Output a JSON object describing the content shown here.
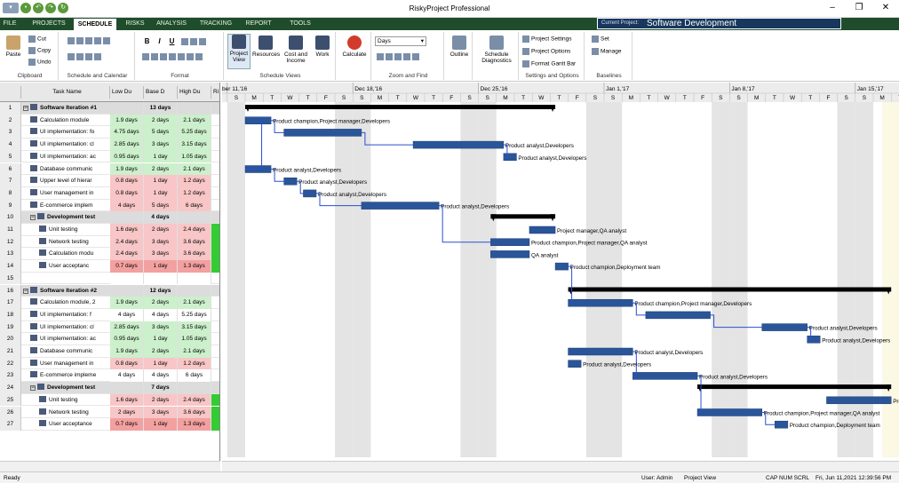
{
  "window": {
    "title": "RiskyProject Professional"
  },
  "tabs": [
    "FILE",
    "PROJECTS",
    "SCHEDULE",
    "RISKS",
    "ANALYSIS",
    "TRACKING",
    "REPORT",
    "TOOLS"
  ],
  "active_tab": "SCHEDULE",
  "current_project": {
    "label": "Current Project:",
    "value": "Software Development"
  },
  "ribbon": {
    "clipboard": {
      "paste": "Paste",
      "cut": "Cut",
      "copy": "Copy",
      "undo": "Undo",
      "label": "Clipboard"
    },
    "schedule_calendar": {
      "label": "Schedule and Calendar"
    },
    "format": {
      "bold": "B",
      "italic": "I",
      "underline": "U",
      "label": "Format"
    },
    "views": {
      "project_view": "Project View",
      "resources": "Resources",
      "cost_income": "Cost and Income",
      "work": "Work",
      "label": "Schedule Views"
    },
    "calculate": {
      "label": "Calculate"
    },
    "zoom": {
      "select_value": "Days",
      "label": "Zoom and Find"
    },
    "outline": {
      "label": "Outline"
    },
    "diagnostics": {
      "label": "Schedule Diagnostics"
    },
    "settings": {
      "project_settings": "Project Settings",
      "project_options": "Project Options",
      "format_gantt": "Format Gantt Bar",
      "label": "Settings and Options"
    },
    "baselines": {
      "set": "Set",
      "manage": "Manage",
      "label": "Baselines"
    }
  },
  "grid": {
    "headers": {
      "task_name": "Task Name",
      "low": "Low Du",
      "base": "Base D",
      "high": "High Du",
      "risk": "Ri"
    },
    "rows": [
      {
        "n": "1",
        "name": "Software Iteration #1",
        "low": "",
        "base": "13 days",
        "high": "",
        "level": 0,
        "summary": true,
        "color": "summ"
      },
      {
        "n": "2",
        "name": "Calculation module",
        "low": "1.9 days",
        "base": "2 days",
        "high": "2.1 days",
        "level": 1,
        "color": "green"
      },
      {
        "n": "3",
        "name": "UI implementation: fo",
        "low": "4.75 days",
        "base": "5 days",
        "high": "5.25 days",
        "level": 1,
        "color": "green"
      },
      {
        "n": "4",
        "name": "UI implementation: cl",
        "low": "2.85 days",
        "base": "3 days",
        "high": "3.15 days",
        "level": 1,
        "color": "green"
      },
      {
        "n": "5",
        "name": "UI implementation: ac",
        "low": "0.95 days",
        "base": "1 day",
        "high": "1.05 days",
        "level": 1,
        "color": "green"
      },
      {
        "n": "6",
        "name": "Database communic",
        "low": "1.9 days",
        "base": "2 days",
        "high": "2.1 days",
        "level": 1,
        "color": "green"
      },
      {
        "n": "7",
        "name": "Upper level of hierar",
        "low": "0.8 days",
        "base": "1 day",
        "high": "1.2 days",
        "level": 1,
        "color": "red"
      },
      {
        "n": "8",
        "name": "User management in",
        "low": "0.8 days",
        "base": "1 day",
        "high": "1.2 days",
        "level": 1,
        "color": "red"
      },
      {
        "n": "9",
        "name": "E-commerce implem",
        "low": "4 days",
        "base": "5 days",
        "high": "6 days",
        "level": 1,
        "color": "red"
      },
      {
        "n": "10",
        "name": "Development test",
        "low": "",
        "base": "4 days",
        "high": "",
        "level": 1,
        "summary": true,
        "color": "summ"
      },
      {
        "n": "11",
        "name": "Unit testing",
        "low": "1.6 days",
        "base": "2 days",
        "high": "2.4 days",
        "level": 2,
        "color": "red",
        "risk": true
      },
      {
        "n": "12",
        "name": "Network testing",
        "low": "2.4 days",
        "base": "3 days",
        "high": "3.6 days",
        "level": 2,
        "color": "red",
        "risk": true
      },
      {
        "n": "13",
        "name": "Calculation modu",
        "low": "2.4 days",
        "base": "3 days",
        "high": "3.6 days",
        "level": 2,
        "color": "red",
        "risk": true
      },
      {
        "n": "14",
        "name": "User acceptanc",
        "low": "0.7 days",
        "base": "1 day",
        "high": "1.3 days",
        "level": 2,
        "color": "redd",
        "risk": true
      },
      {
        "n": "15",
        "name": "",
        "low": "",
        "base": "",
        "high": "",
        "level": 0,
        "color": "none"
      },
      {
        "n": "16",
        "name": "Software Iteration #2",
        "low": "",
        "base": "12 days",
        "high": "",
        "level": 0,
        "summary": true,
        "color": "summ"
      },
      {
        "n": "17",
        "name": "Calculation module, 2",
        "low": "1.9 days",
        "base": "2 days",
        "high": "2.1 days",
        "level": 1,
        "color": "green"
      },
      {
        "n": "18",
        "name": "UI implementation: f",
        "low": "4 days",
        "base": "4 days",
        "high": "5.25 days",
        "level": 1,
        "color": "white"
      },
      {
        "n": "19",
        "name": "UI implementation: cl",
        "low": "2.85 days",
        "base": "3 days",
        "high": "3.15 days",
        "level": 1,
        "color": "green"
      },
      {
        "n": "20",
        "name": "UI implementation: ac",
        "low": "0.95 days",
        "base": "1 day",
        "high": "1.05 days",
        "level": 1,
        "color": "green"
      },
      {
        "n": "21",
        "name": "Database communic",
        "low": "1.9 days",
        "base": "2 days",
        "high": "2.1 days",
        "level": 1,
        "color": "green"
      },
      {
        "n": "22",
        "name": "User management in",
        "low": "0.8 days",
        "base": "1 day",
        "high": "1.2 days",
        "level": 1,
        "color": "red"
      },
      {
        "n": "23",
        "name": "E-commerce impleme",
        "low": "4 days",
        "base": "4 days",
        "high": "6 days",
        "level": 1,
        "color": "white"
      },
      {
        "n": "24",
        "name": "Development test",
        "low": "",
        "base": "7 days",
        "high": "",
        "level": 1,
        "summary": true,
        "color": "summ"
      },
      {
        "n": "25",
        "name": "Unit testing",
        "low": "1.6 days",
        "base": "2 days",
        "high": "2.4 days",
        "level": 2,
        "color": "red",
        "risk": true
      },
      {
        "n": "26",
        "name": "Network testing",
        "low": "2 days",
        "base": "3 days",
        "high": "3.6 days",
        "level": 2,
        "color": "red",
        "risk": true
      },
      {
        "n": "27",
        "name": "User acceptance",
        "low": "0.7 days",
        "base": "1 day",
        "high": "1.3 days",
        "level": 2,
        "color": "redd",
        "risk": true
      }
    ]
  },
  "gantt": {
    "weeks": [
      "ber 11,'16",
      "Dec 18,'16",
      "Dec 25,'16",
      "Jan 1,'17",
      "Jan 8,'17",
      "Jan 15,'17"
    ],
    "day_letters": [
      "M",
      "T",
      "W",
      "T",
      "F",
      "S",
      "S"
    ],
    "bars": [
      {
        "row": 1,
        "start": 0,
        "end": 24,
        "type": "summary"
      },
      {
        "row": 2,
        "start": 0,
        "end": 2,
        "label": "Product champion,Project manager,Developers"
      },
      {
        "row": 3,
        "start": 3,
        "end": 9,
        "label": ""
      },
      {
        "row": 4,
        "start": 13,
        "end": 20,
        "label": "Product analyst,Developers"
      },
      {
        "row": 5,
        "start": 20,
        "end": 21,
        "label": "Product analyst,Developers"
      },
      {
        "row": 6,
        "start": 0,
        "end": 2,
        "label": "Product analyst,Developers"
      },
      {
        "row": 7,
        "start": 3,
        "end": 4,
        "label": "Product analyst,Developers"
      },
      {
        "row": 8,
        "start": 4.5,
        "end": 5.5,
        "label": "Product analyst,Developers"
      },
      {
        "row": 9,
        "start": 9,
        "end": 15,
        "label": "Product analyst,Developers"
      },
      {
        "row": 10,
        "start": 19,
        "end": 24,
        "type": "summary"
      },
      {
        "row": 11,
        "start": 22,
        "end": 24,
        "label": "Project manager,QA analyst"
      },
      {
        "row": 12,
        "start": 19,
        "end": 22,
        "label": "Product champion,Project manager,QA analyst"
      },
      {
        "row": 13,
        "start": 19,
        "end": 22,
        "label": "QA analyst"
      },
      {
        "row": 14,
        "start": 24,
        "end": 25,
        "label": "Product champion,Deployment team"
      },
      {
        "row": 16,
        "start": 25,
        "end": 50,
        "type": "summary"
      },
      {
        "row": 17,
        "start": 25,
        "end": 30,
        "label": "Product champion,Project manager,Developers"
      },
      {
        "row": 18,
        "start": 31,
        "end": 36,
        "label": ""
      },
      {
        "row": 19,
        "start": 40,
        "end": 43.5,
        "label": "Product analyst,Developers"
      },
      {
        "row": 20,
        "start": 43.5,
        "end": 44.5,
        "label": "Product analyst,Developers"
      },
      {
        "row": 21,
        "start": 25,
        "end": 30,
        "label": "Product analyst,Developers"
      },
      {
        "row": 22,
        "start": 25,
        "end": 26,
        "label": "Product analyst,Developers"
      },
      {
        "row": 23,
        "start": 30,
        "end": 35,
        "label": "Product analyst,Developers"
      },
      {
        "row": 24,
        "start": 35,
        "end": 50,
        "type": "summary"
      },
      {
        "row": 25,
        "start": 45,
        "end": 50,
        "label": "Project manager,QA analyst"
      },
      {
        "row": 26,
        "start": 35,
        "end": 40,
        "label": "Product champion,Project manager,QA analyst"
      },
      {
        "row": 27,
        "start": 41,
        "end": 42,
        "label": "Product champion,Deployment team"
      }
    ]
  },
  "status": {
    "left": "Ready",
    "user": "User: Admin",
    "view": "Project View",
    "indicators": "CAP  NUM  SCRL",
    "datetime": "Fri, Jun 11,2021  12:39:56 PM"
  },
  "colors": {
    "tab_bar": "#1f4d2b",
    "bar": "#2a5599",
    "green_cell": "#ccf0cc",
    "red_cell": "#f8c6c6",
    "red_dark": "#f3a0a0",
    "summary_cell": "#dcdcdc",
    "risk": "#33cc33"
  }
}
